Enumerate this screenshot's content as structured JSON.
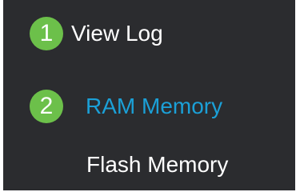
{
  "menu": {
    "items": [
      {
        "label": "View Log",
        "step": "1",
        "state": "default"
      },
      {
        "label": "RAM Memory",
        "step": "2",
        "state": "active"
      },
      {
        "label": "Flash Memory",
        "state": "default"
      }
    ]
  },
  "colors": {
    "panel_bg": "#2b2c2f",
    "text_default": "#ffffff",
    "text_active": "#1ba0d7",
    "badge_green": "#6cc04a"
  },
  "icons": {
    "step_badge": "numbered-circle-badge"
  }
}
